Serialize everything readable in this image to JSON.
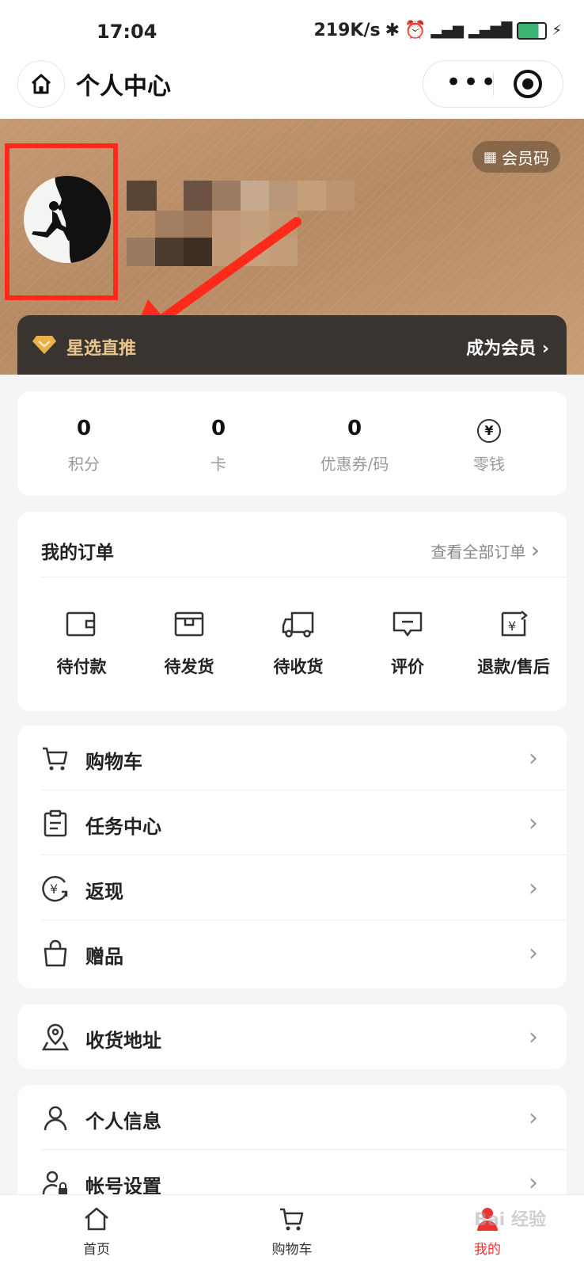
{
  "status_bar": {
    "time": "17:04",
    "network_speed": "219K/s",
    "icons": [
      "bluetooth-icon",
      "alarm-icon",
      "signal-5g-icon",
      "signal-4g-icon",
      "battery-icon",
      "charging-icon"
    ]
  },
  "nav": {
    "title": "个人中心",
    "more_glyph": "•••"
  },
  "hero": {
    "member_code_label": "会员码",
    "vip_name": "星选直推",
    "join_label": "成为会员",
    "highlight_color": "#ff2a1a"
  },
  "stats": [
    {
      "value": "0",
      "label": "积分"
    },
    {
      "value": "0",
      "label": "卡"
    },
    {
      "value": "0",
      "label": "优惠券/码"
    },
    {
      "value": "¥",
      "label": "零钱"
    }
  ],
  "orders": {
    "title": "我的订单",
    "view_all": "查看全部订单",
    "items": [
      {
        "label": "待付款",
        "icon": "wallet-icon"
      },
      {
        "label": "待发货",
        "icon": "package-icon"
      },
      {
        "label": "待收货",
        "icon": "truck-icon"
      },
      {
        "label": "评价",
        "icon": "comment-icon"
      },
      {
        "label": "退款/售后",
        "icon": "refund-icon"
      }
    ]
  },
  "menu": [
    {
      "label": "购物车",
      "icon": "cart-icon"
    },
    {
      "label": "任务中心",
      "icon": "clipboard-icon"
    },
    {
      "label": "返现",
      "icon": "cashback-icon"
    },
    {
      "label": "赠品",
      "icon": "gift-bag-icon"
    }
  ],
  "address": {
    "label": "收货地址",
    "icon": "location-icon"
  },
  "profile_menu": [
    {
      "label": "个人信息",
      "icon": "user-icon"
    },
    {
      "label": "帐号设置",
      "icon": "user-lock-icon"
    }
  ],
  "tabbar": [
    {
      "label": "首页",
      "icon": "home-icon"
    },
    {
      "label": "购物车",
      "icon": "cart-icon"
    },
    {
      "label": "我的",
      "icon": "profile-icon"
    }
  ],
  "watermark": "Bai 经验",
  "colors": {
    "hero": "#c59a73",
    "vip_bar": "#3a3431",
    "vip_text": "#e8c68c",
    "active_tab": "#e33333",
    "highlight": "#ff2a1a"
  }
}
